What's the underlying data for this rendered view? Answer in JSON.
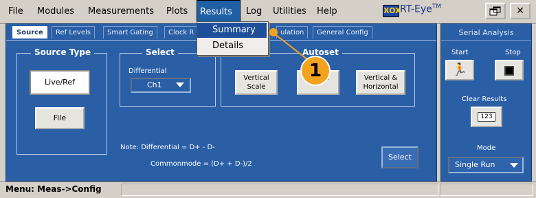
{
  "menubar": {
    "items": [
      "File",
      "Modules",
      "Measurements",
      "Plots",
      "Results",
      "Log",
      "Utilities",
      "Help"
    ],
    "logo_text": "XOX",
    "app_title": "RT-Eye",
    "app_title_mark": "TM"
  },
  "results_menu": {
    "items": [
      "Summary",
      "Details"
    ],
    "highlighted": "Summary"
  },
  "tabs": [
    "Source",
    "Ref Levels",
    "Smart Gating",
    "Clock R",
    "ulation",
    "General Config"
  ],
  "source_type": {
    "title": "Source Type",
    "live_ref_label": "Live/Ref",
    "file_label": "File"
  },
  "select_group": {
    "title": "Select",
    "differential_label": "Differential",
    "channel_value": "Ch1"
  },
  "autoset": {
    "title": "Autoset",
    "vertical_scale_label": "Vertical Scale",
    "horizontal_position_label": "al tion",
    "vertical_horizontal_label": "Vertical & Horizontal"
  },
  "notes": {
    "line1": "Note: Differential     = D+ - D-",
    "line2": "Commonmode = (D+ + D-)/2"
  },
  "select_button_label": "Select",
  "right_panel": {
    "header": "Serial Analysis",
    "start_label": "Start",
    "stop_label": "Stop",
    "clear_results_label": "Clear Results",
    "clear_results_icon_text": "123",
    "mode_label": "Mode",
    "mode_value": "Single Run"
  },
  "callout": {
    "number": "1",
    "color": "#f4a31e"
  },
  "statusbar": {
    "text": "Menu: Meas->Config"
  },
  "colors": {
    "panel_blue": "#2a5fa6",
    "menu_highlight": "#1f4f9a",
    "chrome_gray": "#d4d0c8"
  },
  "icons": [
    "runner-icon",
    "stop-square-icon",
    "eraser-icon",
    "chevron-down-icon",
    "restore-window-icon",
    "close-icon"
  ]
}
